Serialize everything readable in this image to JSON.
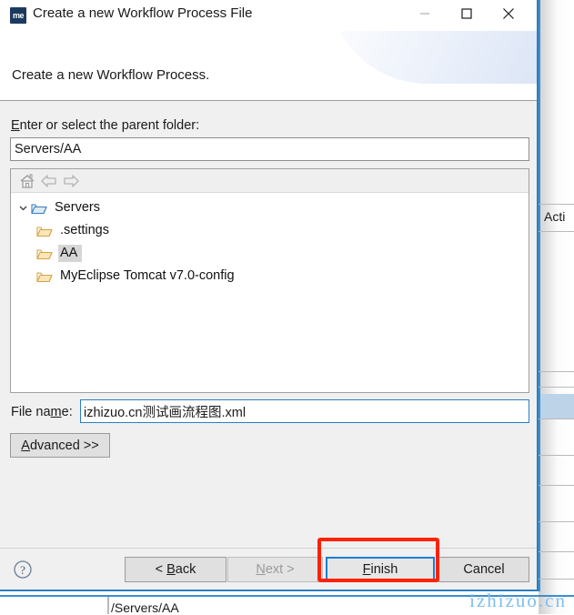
{
  "window": {
    "title": "Create a new Workflow Process File",
    "icon": "myeclipse-icon",
    "controls": {
      "minimize": "minimize-icon",
      "maximize": "maximize-icon",
      "close": "close-icon"
    }
  },
  "header": {
    "title": "Create a new Workflow Process."
  },
  "parent_folder": {
    "label_pre": "E",
    "label_post": "nter or select the parent folder:",
    "value": "Servers/AA"
  },
  "tree_toolbar": {
    "home": "home-icon",
    "back": "back-arrow-icon",
    "forward": "forward-arrow-icon"
  },
  "tree": {
    "items": [
      {
        "label": "Servers",
        "level": 1,
        "expanded": true,
        "selected": false
      },
      {
        "label": ".settings",
        "level": 2,
        "expanded": false,
        "selected": false
      },
      {
        "label": "AA",
        "level": 2,
        "expanded": false,
        "selected": true
      },
      {
        "label": "MyEclipse Tomcat v7.0-config",
        "level": 2,
        "expanded": false,
        "selected": false
      }
    ]
  },
  "file_name": {
    "label_pre": "File na",
    "label_mn": "m",
    "label_post": "e:",
    "value": "izhizuo.cn测试画流程图.xml"
  },
  "advanced": {
    "label_mn": "A",
    "label_post": "dvanced >>"
  },
  "buttons": {
    "help": "help-icon",
    "back": {
      "pre": "< ",
      "mn": "B",
      "post": "ack",
      "enabled": true
    },
    "next": {
      "pre": "",
      "mn": "N",
      "post": "ext >",
      "enabled": false
    },
    "finish": {
      "pre": "",
      "mn": "F",
      "post": "inish",
      "enabled": true,
      "focused": true
    },
    "cancel": {
      "pre": "",
      "mn": "",
      "post": "Cancel",
      "enabled": true
    }
  },
  "annotation": {
    "shape": "red-rectangle",
    "target": "finish-button",
    "color": "#ff2200"
  },
  "background": {
    "action_label": "Acti",
    "path_label": "/Servers/AA"
  },
  "watermark": {
    "text": "izhizuo.cn",
    "color": "#7fbff0"
  }
}
